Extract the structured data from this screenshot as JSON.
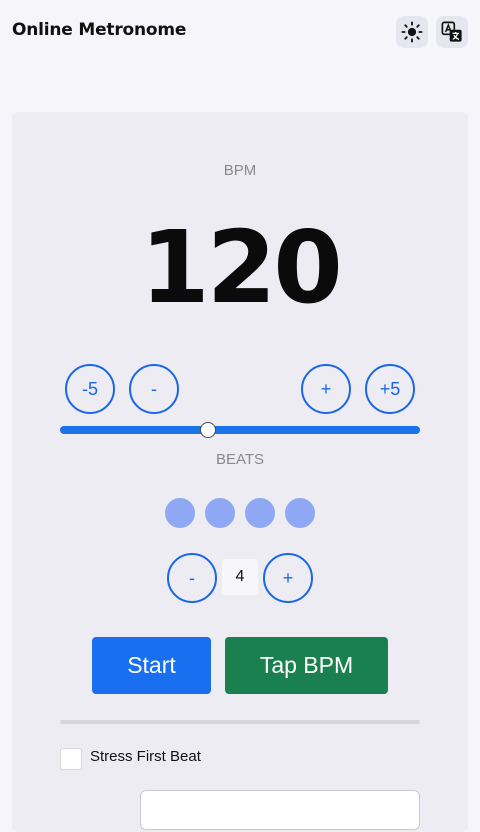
{
  "header": {
    "title": "Online Metronome",
    "theme_icon": "sun-icon",
    "language_icon": "translate-icon"
  },
  "bpm": {
    "label": "BPM",
    "value": "120",
    "minus5": "-5",
    "minus1": "-",
    "plus1": "+",
    "plus5": "+5",
    "slider_fraction": 0.41
  },
  "beats": {
    "label": "BEATS",
    "count": "4",
    "minus": "-",
    "plus": "+",
    "indicators": 4
  },
  "controls": {
    "start_label": "Start",
    "tap_label": "Tap BPM"
  },
  "options": {
    "stress_first_beat_label": "Stress First Beat",
    "stress_first_beat_checked": false
  },
  "colors": {
    "accent": "#1a6ff0",
    "tap": "#1b8050",
    "beat_dot": "#8fa8f4"
  }
}
